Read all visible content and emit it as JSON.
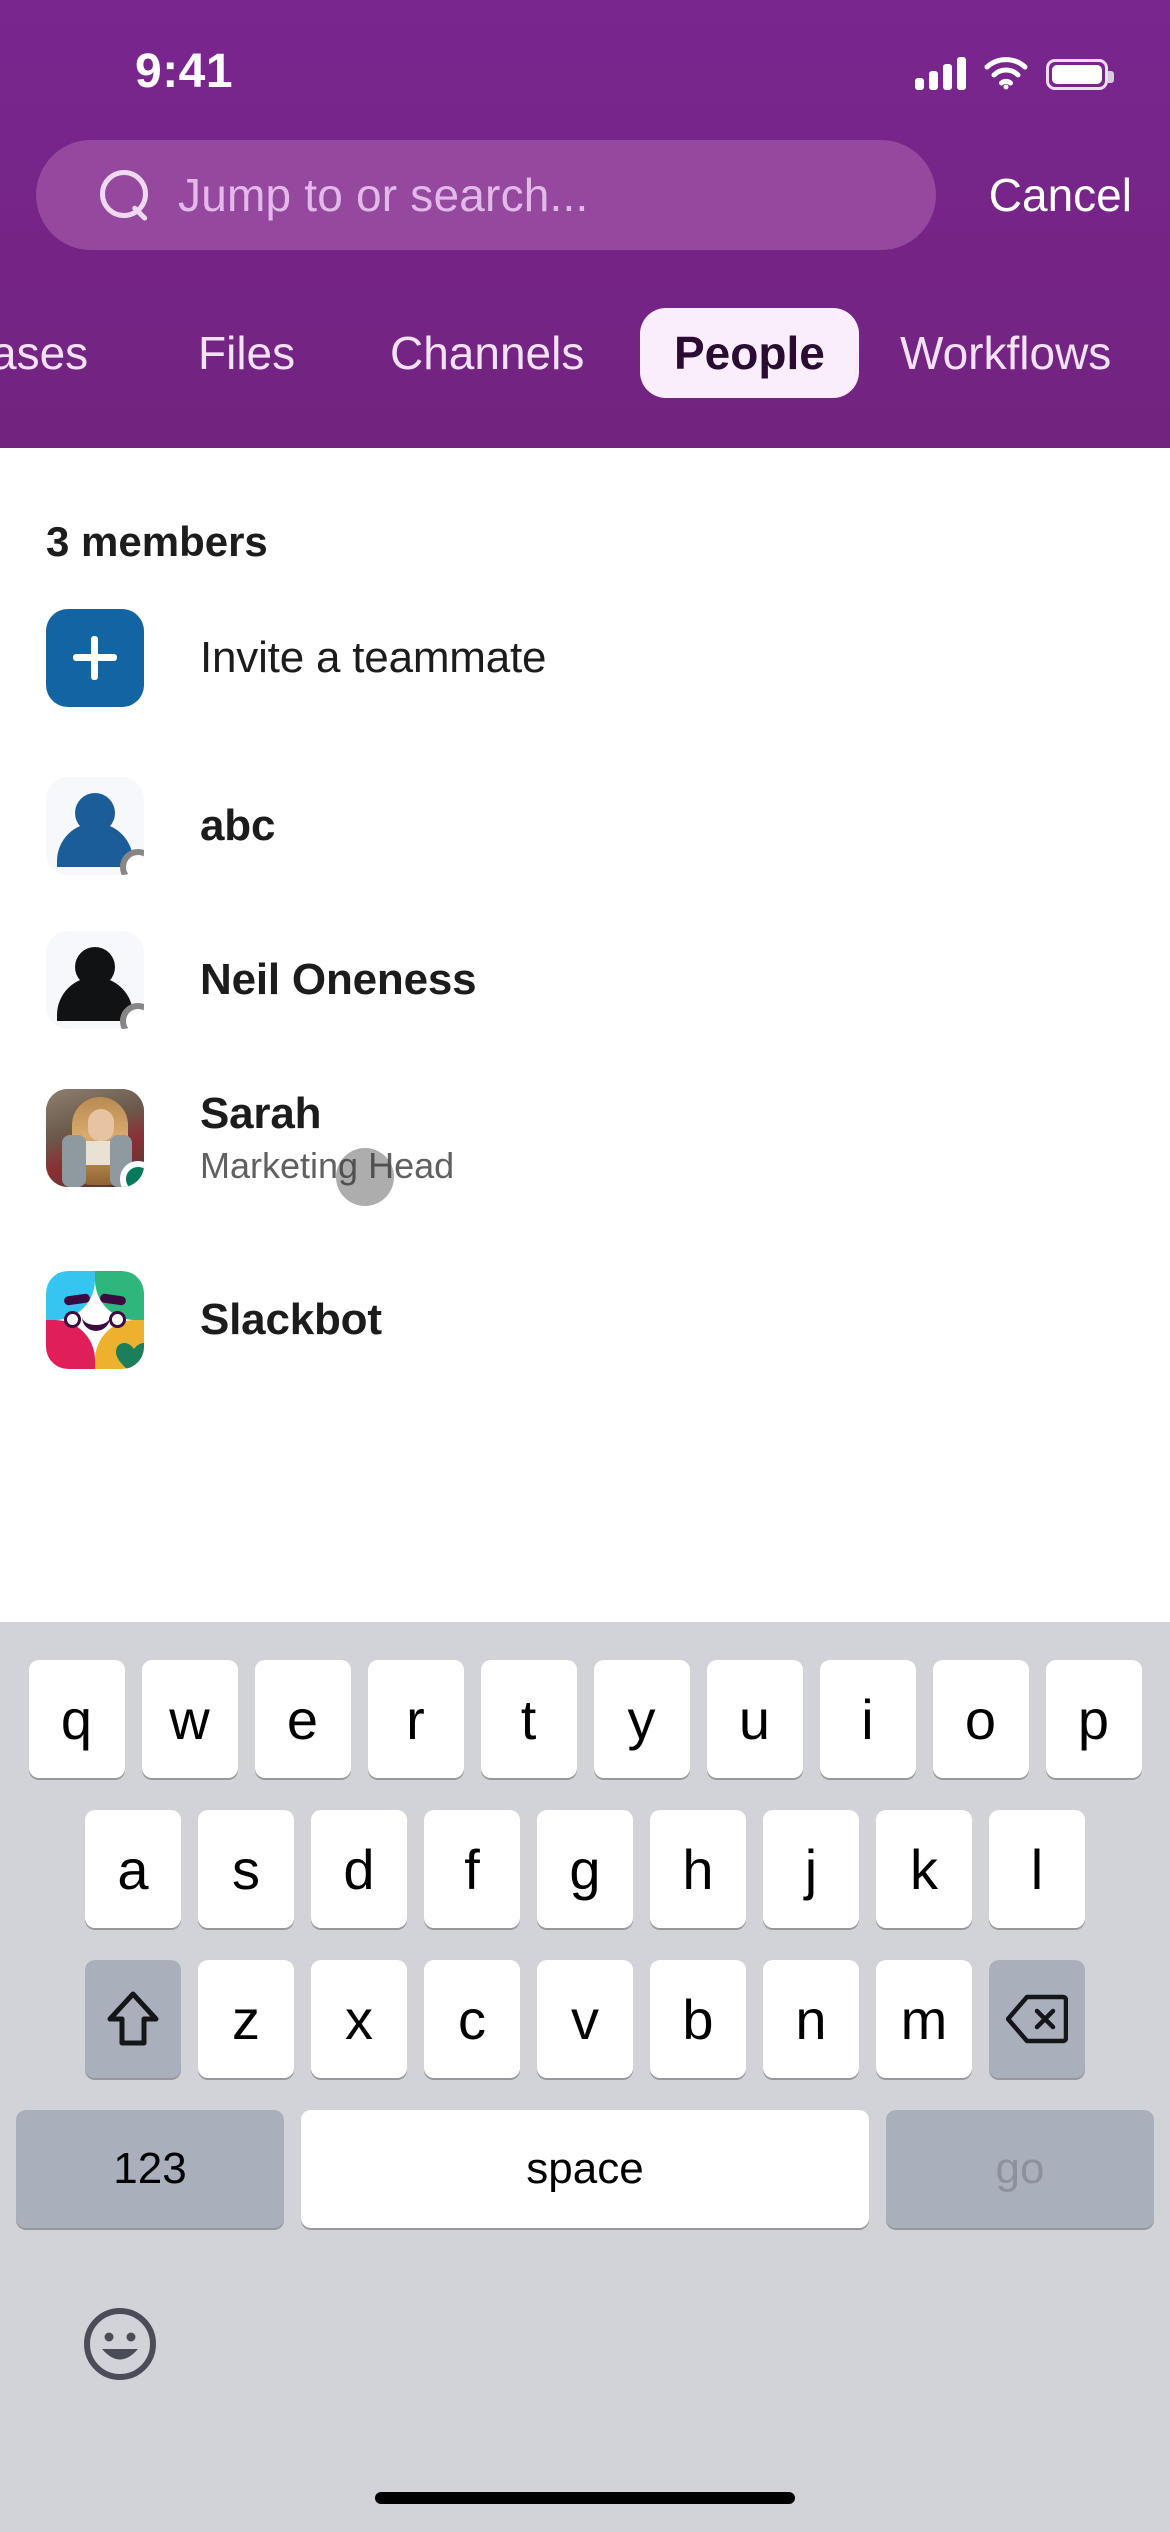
{
  "status_bar": {
    "time": "9:41",
    "signal_icon": "cellular-signal-icon",
    "wifi_icon": "wifi-icon",
    "battery_icon": "battery-full-icon"
  },
  "header": {
    "accent_purple": "#74258b",
    "search_field_bg": "#94499f",
    "search": {
      "placeholder": "Jump to or search...",
      "value": "",
      "icon": "search-icon"
    },
    "cancel_label": "Cancel"
  },
  "tabs": {
    "selected": "People",
    "selected_bg": "#fbeefc",
    "items": [
      {
        "label": "vases",
        "selected": false,
        "truncated": true
      },
      {
        "label": "Files",
        "selected": false
      },
      {
        "label": "Channels",
        "selected": false
      },
      {
        "label": "People",
        "selected": true
      },
      {
        "label": "Workflows",
        "selected": false
      }
    ]
  },
  "results": {
    "section_title": "3 members",
    "invite": {
      "label": "Invite a teammate",
      "icon": "plus-icon",
      "icon_bg": "#1264a3"
    },
    "members": [
      {
        "name": "abc",
        "subtitle": "",
        "avatar": "person-silhouette-blue-avatar",
        "presence": "offline",
        "presence_color": "#868686"
      },
      {
        "name": "Neil Oneness",
        "subtitle": "",
        "avatar": "person-silhouette-black-avatar",
        "presence": "offline",
        "presence_color": "#868686"
      },
      {
        "name": "Sarah",
        "subtitle": "Marketing Head",
        "avatar": "photo-avatar",
        "presence": "online",
        "presence_color": "#007a5a"
      },
      {
        "name": "Slackbot",
        "subtitle": "",
        "avatar": "slackbot-avatar",
        "presence": "heart",
        "presence_color": "#007a5a"
      }
    ]
  },
  "keyboard": {
    "row1": [
      "q",
      "w",
      "e",
      "r",
      "t",
      "y",
      "u",
      "i",
      "o",
      "p"
    ],
    "row2": [
      "a",
      "s",
      "d",
      "f",
      "g",
      "h",
      "j",
      "k",
      "l"
    ],
    "row3": [
      "z",
      "x",
      "c",
      "v",
      "b",
      "n",
      "m"
    ],
    "shift_icon": "shift-icon",
    "backspace_icon": "backspace-icon",
    "numbers_label": "123",
    "space_label": "space",
    "go_label": "go",
    "emoji_icon": "emoji-smiley-icon"
  },
  "home_indicator": "home-indicator"
}
